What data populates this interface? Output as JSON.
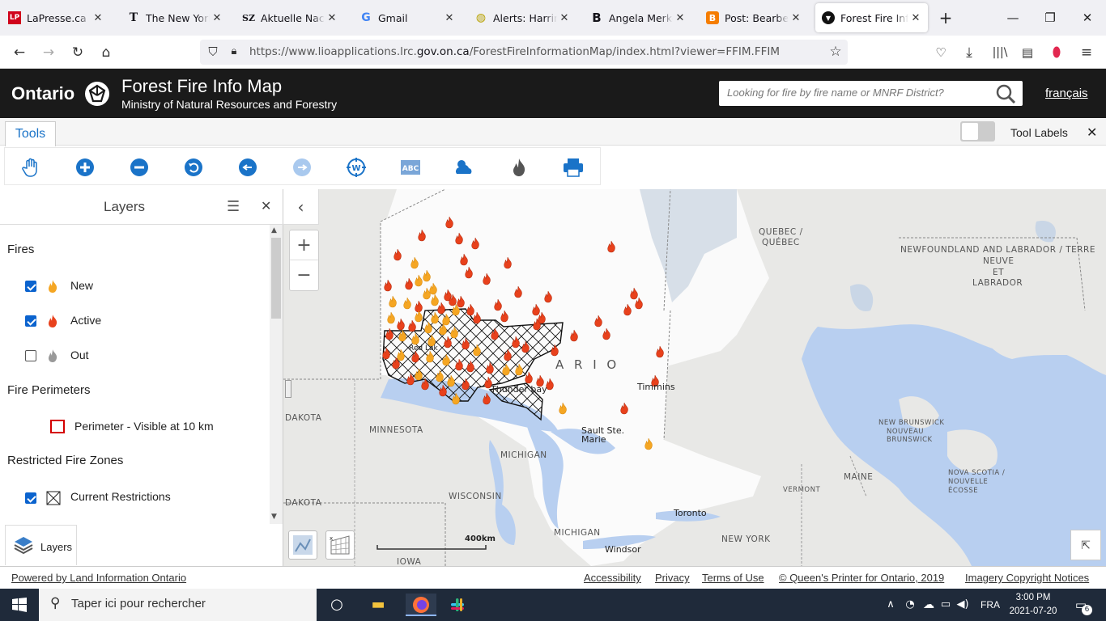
{
  "browser": {
    "tabs": [
      {
        "label": "LaPresse.ca | Actualités",
        "icon": "lapresse-icon",
        "fav": "LP"
      },
      {
        "label": "The New York Times",
        "icon": "nyt-icon",
        "fav": "T"
      },
      {
        "label": "Aktuelle Nachrichten",
        "icon": "sz-icon",
        "fav": "SZ"
      },
      {
        "label": "Gmail",
        "icon": "google-icon",
        "fav": "G"
      },
      {
        "label": "Alerts: Harrington",
        "icon": "alerts-icon",
        "fav": "◍"
      },
      {
        "label": "Angela Merkel's",
        "icon": "bold-b-icon",
        "fav": "B"
      },
      {
        "label": "Post: Bearbeiten",
        "icon": "blogger-icon",
        "fav": "B"
      },
      {
        "label": "Forest Fire Info Map",
        "icon": "ontario-icon",
        "fav": "▼"
      }
    ],
    "url_prefix": "https://www.lioapplications.lrc.",
    "url_domain": "gov.on.ca",
    "url_suffix": "/ForestFireInformationMap/index.html?viewer=FFIM.FFIM"
  },
  "header": {
    "logo": "Ontario",
    "title": "Forest Fire Info Map",
    "subtitle": "Ministry of Natural Resources and Forestry",
    "search_placeholder": "Looking for fire by fire name or MNRF District?",
    "language_link": "français"
  },
  "tools": {
    "tab_label": "Tools",
    "tool_labels_toggle": "Tool Labels",
    "tool_labels_on": false,
    "toolbar": [
      "pan-hand-icon",
      "zoom-in-icon",
      "zoom-out-icon",
      "refresh-icon",
      "back-icon",
      "forward-icon",
      "geocode-icon",
      "abc-label-icon",
      "weather-icon",
      "fire-icon",
      "print-icon"
    ]
  },
  "layers": {
    "title": "Layers",
    "sections": {
      "fires": "Fires",
      "perimeters": "Fire Perimeters",
      "restricted": "Restricted Fire Zones"
    },
    "items": {
      "new": {
        "label": "New",
        "checked": true
      },
      "active": {
        "label": "Active",
        "checked": true
      },
      "out": {
        "label": "Out",
        "checked": false
      },
      "perimeter": {
        "label": "Perimeter - Visible at 10 km"
      },
      "restrictions": {
        "label": "Current Restrictions",
        "checked": true
      }
    },
    "button_label": "Layers"
  },
  "map": {
    "labels": {
      "quebec": "QUEBEC /",
      "quebec2": "QUÉBEC",
      "nfld": "NEWFOUNDLAND AND LABRADOR / TERRE",
      "nfld2": "NEUVE",
      "nfld3": "ET",
      "nfld4": "LABRADOR",
      "ontario": "A R I O",
      "dakota1": "DAKOTA",
      "minnesota": "MINNESOTA",
      "michigan1": "MICHIGAN",
      "wisconsin": "WISCONSIN",
      "dakota2": "DAKOTA",
      "michigan2": "MICHIGAN",
      "iowa": "IOWA",
      "newyork": "NEW YORK",
      "maine": "MAINE",
      "vermont": "VERMONT",
      "nb1": "NEW BRUNSWICK",
      "nb2": "NOUVEAU",
      "nb3": "BRUNSWICK",
      "ns1": "NOVA SCOTIA /",
      "ns2": "NOUVELLE",
      "ns3": "ÉCOSSE",
      "thunderbay": "Thunder bay",
      "timmins": "Timmins",
      "saultste": "Sault Ste.",
      "marie": "Marie",
      "toronto": "Toronto",
      "windsor": "Windsor",
      "redlake": "Red Lak"
    },
    "scale": "400km"
  },
  "footer": {
    "powered": "Powered by Land Information Ontario",
    "links": [
      "Accessibility",
      "Privacy",
      "Terms of Use",
      "© Queen's Printer for Ontario, 2019",
      "Imagery Copyright Notices"
    ]
  },
  "taskbar": {
    "search": "Taper ici pour rechercher",
    "lang": "FRA",
    "time": "3:00 PM",
    "date": "2021-07-20",
    "notifications": "6"
  },
  "colors": {
    "header_bg": "#1a1a1a",
    "accent_blue": "#0b63ce",
    "active_fire": "#e8411c",
    "new_fire": "#f5a623"
  }
}
